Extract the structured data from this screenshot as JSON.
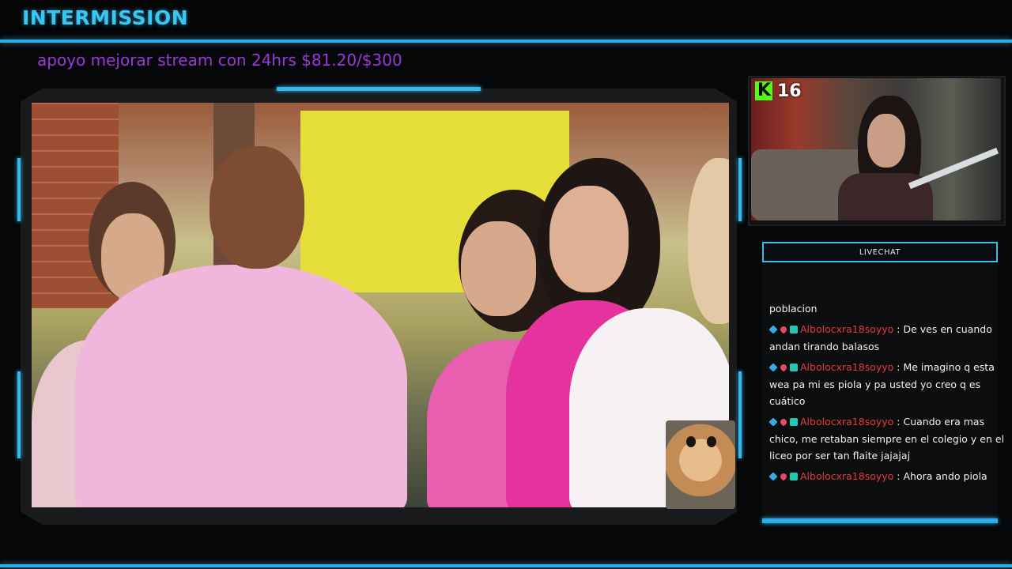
{
  "header": {
    "title": "INTERMISSION"
  },
  "goal": {
    "text": "apoyo mejorar stream con 24hrs $81.20/$300"
  },
  "webcam": {
    "platform_icon": "kick-icon",
    "viewer_count": "16"
  },
  "chat": {
    "header": "LIVECHAT",
    "messages": [
      {
        "username": "",
        "text": "poblacion",
        "badges": []
      },
      {
        "username": "Albolocxra18soyyo",
        "text": "De ves en cuando andan tirando balasos",
        "badges": [
          "cube-badge-icon",
          "heart-badge-icon",
          "gift-badge-icon"
        ]
      },
      {
        "username": "Albolocxra18soyyo",
        "text": "Me imagino q esta wea pa mi es piola y pa usted yo creo q es cuático",
        "badges": [
          "cube-badge-icon",
          "heart-badge-icon",
          "gift-badge-icon"
        ]
      },
      {
        "username": "Albolocxra18soyyo",
        "text": "Cuando era mas chico, me retaban siempre en el colegio y en el liceo por ser tan flaite jajajaj",
        "badges": [
          "cube-badge-icon",
          "heart-badge-icon",
          "gift-badge-icon"
        ]
      },
      {
        "username": "Albolocxra18soyyo",
        "text": "Ahora ando piola",
        "badges": [
          "cube-badge-icon",
          "heart-badge-icon",
          "gift-badge-icon"
        ]
      }
    ]
  },
  "colors": {
    "accent": "#2aaee6",
    "brand": "#38c6f4",
    "goal": "#9b38d8",
    "username": "#e83a3a",
    "kick_green": "#53fc18"
  }
}
